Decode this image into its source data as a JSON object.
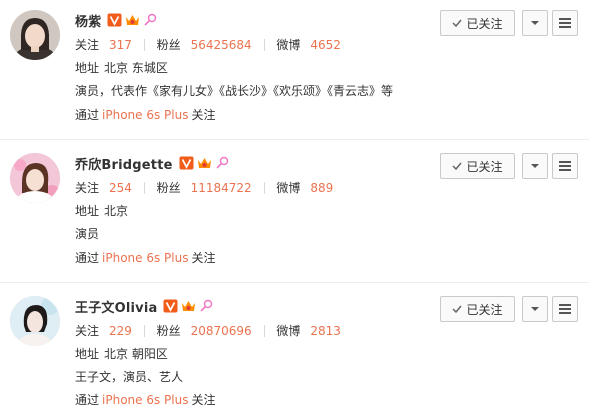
{
  "labels": {
    "follow": "关注",
    "fans": "粉丝",
    "weibo": "微博",
    "address": "地址",
    "via": "通过",
    "followed_button": "已关注"
  },
  "colors": {
    "accent": "#eb7350",
    "verified": "#f25c19",
    "crown": "#ff8c00"
  },
  "users": [
    {
      "name": "杨紫",
      "following": "317",
      "fans": "56425684",
      "weibo": "4652",
      "address": "北京 东城区",
      "bio": "演员，代表作《家有儿女》《战长沙》《欢乐颂》《青云志》等",
      "device": "iPhone 6s Plus",
      "suffix": "关注"
    },
    {
      "name": "乔欣Bridgette",
      "following": "254",
      "fans": "11184722",
      "weibo": "889",
      "address": "北京",
      "bio": "演员",
      "device": "iPhone 6s Plus",
      "suffix": "关注"
    },
    {
      "name": "王子文Olivia",
      "following": "229",
      "fans": "20870696",
      "weibo": "2813",
      "address": "北京 朝阳区",
      "bio": "王子文，演员、艺人",
      "device": "iPhone 6s Plus",
      "suffix": "关注"
    }
  ]
}
